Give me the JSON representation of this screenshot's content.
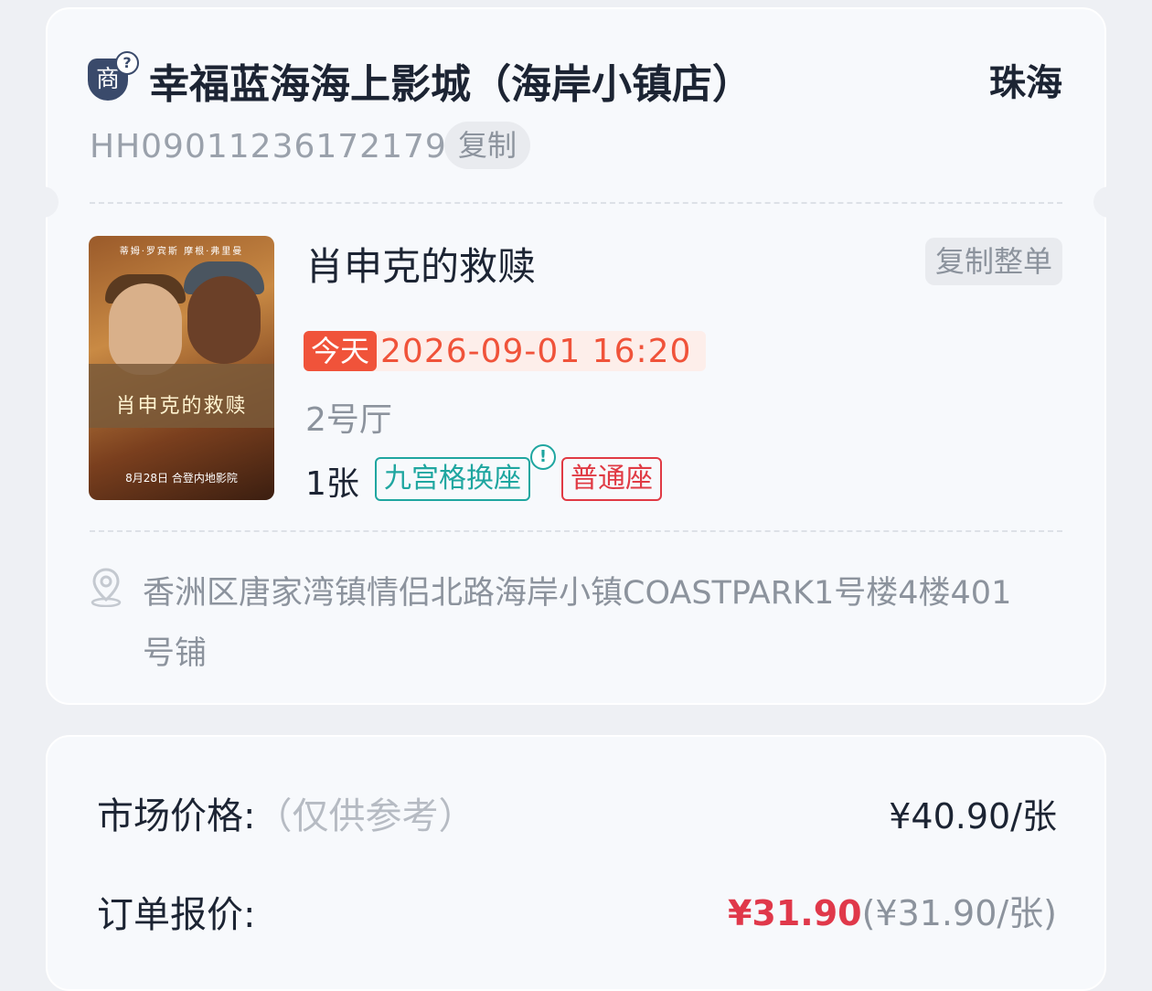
{
  "cinema": {
    "merchant_badge": "商",
    "help_mark": "?",
    "name": "幸福蓝海海上影城（海岸小镇店）",
    "city": "珠海",
    "order_no": "HH090112361721792",
    "copy_label": "复制"
  },
  "movie": {
    "title": "肖申克的救赎",
    "copy_all_label": "复制整单",
    "today_tag": "今天",
    "showtime": "2026-09-01 16:20",
    "hall": "2号厅",
    "tickets": "1张",
    "tag_seat_grid": "九宫格换座",
    "info_mark": "!",
    "tag_normal": "普通座",
    "poster": {
      "cast": "蒂姆·罗宾斯   摩根·弗里曼",
      "title": "肖申克的救赎",
      "date": "8月28日 合登内地影院"
    }
  },
  "address": "香洲区唐家湾镇情侣北路海岸小镇COASTPARK1号楼4楼401号铺",
  "pricing": {
    "market_label": "市场价格:",
    "market_note": "（仅供参考）",
    "market_value": "¥40.90/张",
    "quote_label": "订单报价:",
    "quote_total": "¥31.90",
    "quote_unit": "(¥31.90/张)"
  },
  "icons": {
    "location": "location-pin-icon"
  }
}
